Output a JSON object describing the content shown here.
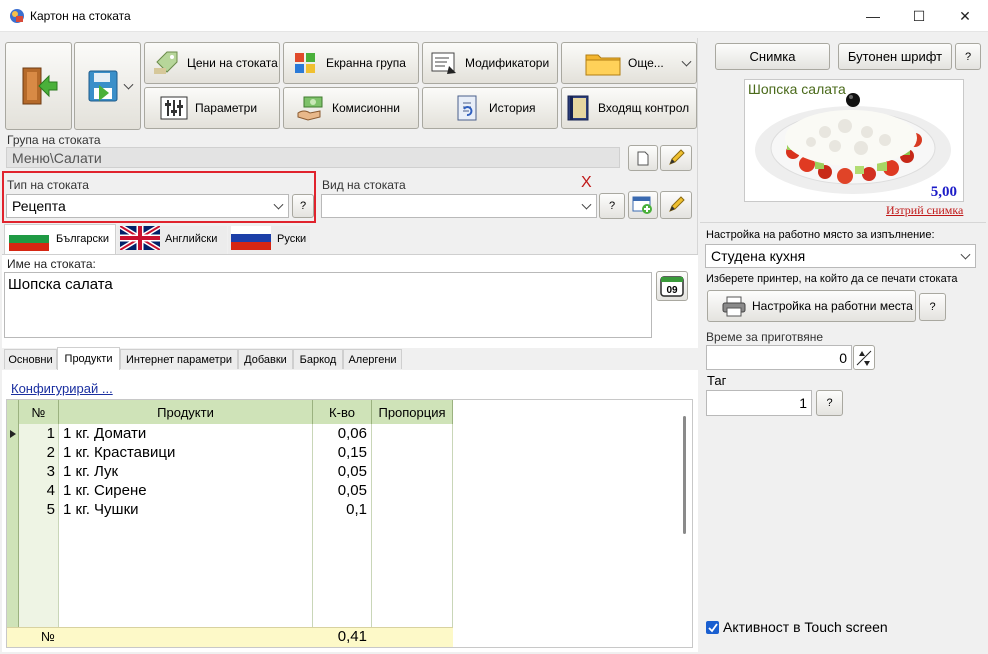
{
  "window": {
    "title": "Картон на стоката",
    "controls": {
      "minimize": "—",
      "maximize": "☐",
      "close": "✕"
    }
  },
  "toolbar": {
    "prices": "Цени на стоката",
    "screen_group": "Екранна група",
    "modifiers": "Модификатори",
    "other": "Още...",
    "parameters": "Параметри",
    "commission": "Комисионни",
    "history": "История",
    "incoming_control": "Входящ контрол"
  },
  "group": {
    "label": "Група на стоката",
    "value": "Меню\\Салати"
  },
  "type": {
    "label": "Тип на стоката",
    "value": "Рецепта",
    "help": "?"
  },
  "kind": {
    "label": "Вид на стоката",
    "value": "",
    "clear": "X",
    "help": "?"
  },
  "languages": [
    {
      "label": "Български"
    },
    {
      "label": "Английски"
    },
    {
      "label": "Руски"
    }
  ],
  "name": {
    "label": "Име на стоката:",
    "value": "Шопска салата",
    "calendar_day": "09"
  },
  "tabs": [
    "Основни",
    "Продукти",
    "Интернет параметри",
    "Добавки",
    "Баркод",
    "Алергени"
  ],
  "configure_link": "Конфигурирай ...",
  "grid": {
    "headers": [
      "№",
      "Продукти",
      "К-во",
      "Пропорция"
    ],
    "rows": [
      {
        "no": "1",
        "product": "1 кг. Домати",
        "qty": "0,06"
      },
      {
        "no": "2",
        "product": "1 кг. Краставици",
        "qty": "0,15"
      },
      {
        "no": "3",
        "product": "1 кг. Лук",
        "qty": "0,05"
      },
      {
        "no": "4",
        "product": "1 кг. Сирене",
        "qty": "0,05"
      },
      {
        "no": "5",
        "product": "1 кг. Чушки",
        "qty": "0,1"
      }
    ],
    "footer": {
      "no": "№",
      "qty": "0,41"
    }
  },
  "right": {
    "photo_btn": "Снимка",
    "font_btn": "Бутонен шрифт",
    "help": "?",
    "photo_caption": "Шопска салата",
    "photo_price": "5,00",
    "delete_photo": "Изтрий снимка",
    "workplace_label": "Настройка на работно място за изпълнение:",
    "workplace_value": "Студена кухня",
    "printer_label": "Изберете принтер, на който да се печати стоката",
    "workplace_btn": "Настройка на работни места",
    "prep_time_label": "Време за приготвяне",
    "prep_time_value": "0",
    "tag_label": "Таг",
    "tag_value": "1",
    "touch_label": "Активност в Touch screen"
  },
  "colors": {
    "highlight": "#e0232d",
    "grid_header": "#cfe3b8",
    "footer": "#fdf9c8",
    "link": "#1a2fa0",
    "price": "#1c1cc8",
    "delete": "#c01818"
  }
}
